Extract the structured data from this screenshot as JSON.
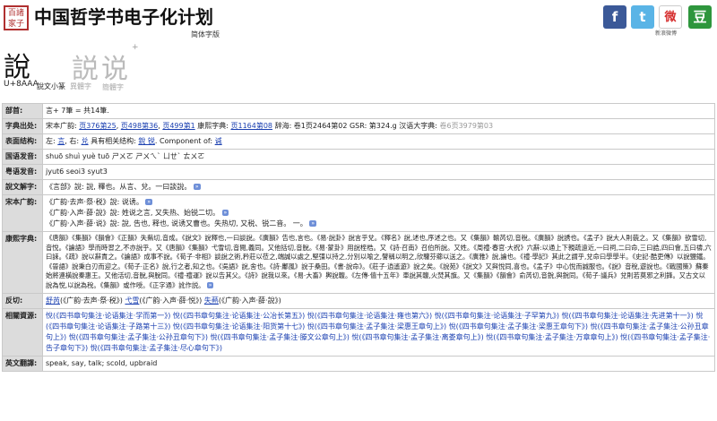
{
  "header": {
    "seal_text": "百諸家子",
    "title": "中国哲学书电子化计划",
    "simplified_label": "简体字版",
    "share": {
      "facebook": "f",
      "twitter": "t",
      "weibo": "微",
      "weibo_label": "新浪微博",
      "douban": "豆"
    }
  },
  "glyph": {
    "main": "說",
    "seal": "𧧎",
    "variant1": "説",
    "variant2": "说",
    "plus": "+",
    "unicode": "U+8AAA",
    "caption_seal": "說文小篆",
    "caption_variant1": "異體字",
    "caption_variant2": "簡體字"
  },
  "rows": {
    "bushou": {
      "label": "部首:",
      "value": "言+ 7筆 = 共14筆."
    },
    "chuchu": {
      "label": "字典出处:",
      "prefix": "宋本广韵: ",
      "links": [
        "页376第25",
        "页498第36",
        "页499第1"
      ],
      "mid": " 康熙字典: ",
      "kangxi_link": "页1164第08",
      "rest": " 辞海: 卷1页2464第02 GSR: 第324.g 汉语大字典: ",
      "gray_tail": "卷6页3979第03"
    },
    "biaoyi": {
      "label": "表面结构:",
      "parts": [
        "左: ",
        "言",
        ", 右: ",
        "兑",
        "  具有相关结构: ",
        "銳 锐",
        ".   Component of: ",
        "𫍯"
      ]
    },
    "guoyu": {
      "label": "国语发音:",
      "value": "shuō shuì yuè tuō  ㄕㄨㄛ  ㄕㄨㄟˋ  ㄩㄝˋ  ㄊㄨㄛ"
    },
    "yueyu": {
      "label": "粤语发音:",
      "value": "jyut6 seoi3 syut3"
    },
    "shuowen": {
      "label": "說文解字:",
      "value": "《言部》說: 說, 釋也。从言、兌。一曰談說。"
    },
    "songben": {
      "label": "宋本广韵:",
      "lines": [
        "《广韵·去声·祭·税》說: 说诱。",
        "《广韵·入声·薛·說》說: 姓说之言, 又失热、始锐二切。",
        "《广韵·入声·薛·说》說: 說, 告也, 释也, 说诱又曹也。失热切, 又税、锐二音。 一。"
      ]
    },
    "kangxi": {
      "label": "康熙字典:",
      "text": "《唐韻》《集韻》《韻會》《正韻》失爇切,音成。《說文》說釋也,一曰談說。《廣韻》告也,言也。《易·說卦》說言乎兌。《釋名》說,述也,序述之也。又《集韻》輸芮切,音稅。《廣韻》說誘也。《孟子》說大人則藐之。又《集韻》欲雪切,音悅。《論語》學而時習之,不亦說乎。又《唐韻》《集韻》弋雪切,音閱,義同。又他括切,音脫。《易·蒙卦》用說桎梏。又《詩·召南》召伯所說。又姓。《周禮·春官·大祝》六辭:以通上下親疏遠近,一曰祠,二曰命,三曰誥,四曰會,五曰禱,六曰誄。《疏》說以辭責之。《論語》成事不說。《荀子·非相》談說之術,矜莊以莅之,端誠以處之,堅彊以持之,分別以喻之,譬稱以明之,欣驩芬薌以送之。《廣雅》說,論也。《禮·學記》其此之謂乎,兌命曰學學半。《史記·酷吏傳》以說鹽鐵。《晉語》說秉白刃而迎之。《荀子·正名》說,行之者,知之也。《吳語》說,舍也。《詩·鄘風》說于桑田。《書·說命》。《莊子·逍遙遊》說之矣。《說苑》《說文》又與悅同,喜也。《孟子》中心悅而誠服也。《說》音稅,遊說也。《戰國策》蘇秦始將連橫說秦惠王。又他活切,音脫,與脫同。《禮·禮運》說以告其父。《詩》說我以來。《易·大畜》輿說輹。《左傳·僖十五年》車說其輹,火焚其旗。又《集韻》《韻會》俞芮切,音銳,與銳同。《荀子·議兵》兌則若莫邪之利鋒。又古文以說為悅,以說為稅。《集韻》或作㖟。《正字通》訛作説。"
    },
    "fanqie": {
      "label": "反切:",
      "parts": [
        "舒芮",
        "(《广韵·去声·祭·税》)",
        "弋雪",
        "(《广韵·入声·薛·悦》)",
        "失爇",
        "(《广韵·入声·薛·說》)"
      ]
    },
    "xiangguan": {
      "label": "相關資源:",
      "text": "悅(《四书章句集注·论语集注·学而第一》) 悅(《四书章句集注·论语集注·公冶长第五》) 悅(《四书章句集注·论语集注·雍也第六》) 悅(《四书章句集注·论语集注·子罕第九》) 悅(《四书章句集注·论语集注·先进第十一》) 悅(《四书章句集注·论语集注·子路第十三》) 悅(《四书章句集注·论语集注·阳货第十七》) 悅(《四书章句集注·孟子集注·梁惠王章句上》) 悅(《四书章句集注·孟子集注·梁惠王章句下》) 悅(《四书章句集注·孟子集注·公孙丑章句上》) 悅(《四书章句集注·孟子集注·公孙丑章句下》) 悅(《四书章句集注·孟子集注·滕文公章句上》) 悅(《四书章句集注·孟子集注·离娄章句上》) 悅(《四书章句集注·孟子集注·万章章句上》) 悅(《四书章句集注·孟子集注·告子章句下》) 悅(《四书章句集注·孟子集注·尽心章句下》)"
    },
    "yingwen": {
      "label": "英文翻譯:",
      "value": "speak, say, talk; scold, upbraid"
    }
  }
}
